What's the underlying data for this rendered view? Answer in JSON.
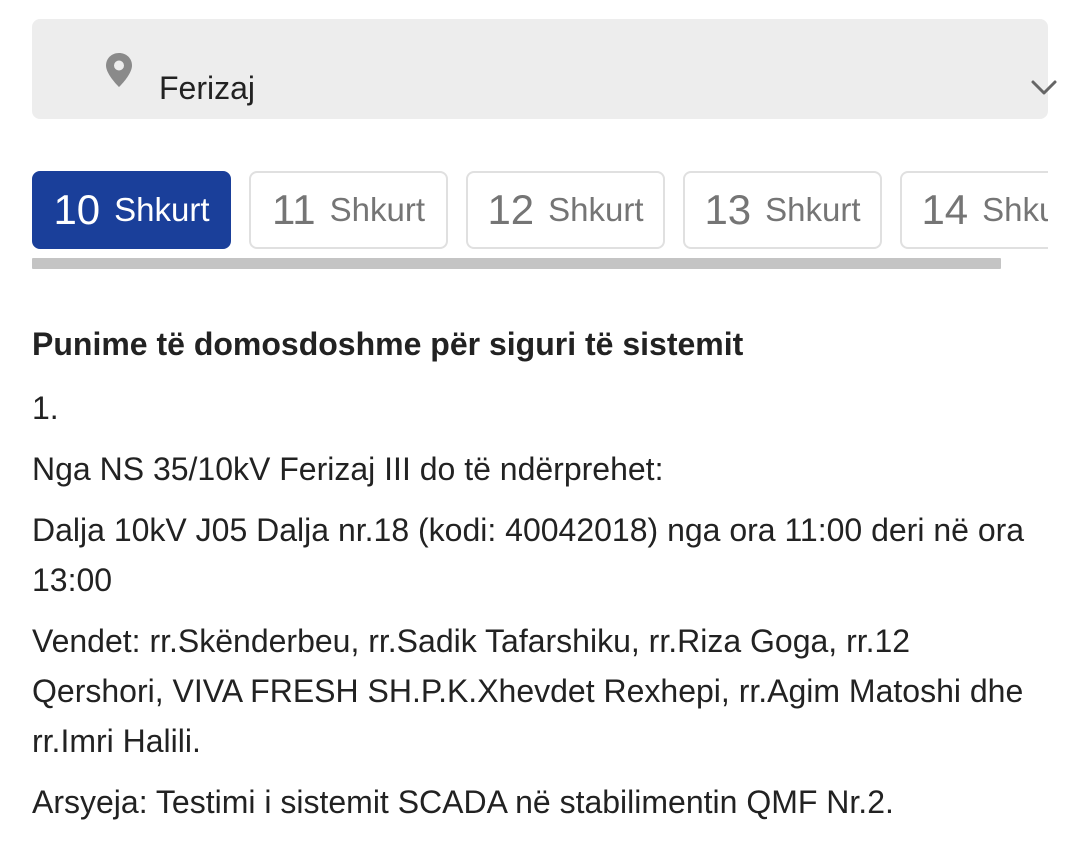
{
  "location": {
    "value": "Ferizaj",
    "pin_icon": "map-pin-icon",
    "dropdown_icon": "chevron-down-icon"
  },
  "tabs": [
    {
      "day": "10",
      "month": "Shkurt",
      "active": true
    },
    {
      "day": "11",
      "month": "Shkurt",
      "active": false
    },
    {
      "day": "12",
      "month": "Shkurt",
      "active": false
    },
    {
      "day": "13",
      "month": "Shkurt",
      "active": false
    },
    {
      "day": "14",
      "month": "Shkurt",
      "active": false
    }
  ],
  "colors": {
    "active_tab": "#1a3f9a",
    "select_bg": "#ededed",
    "scrollbar": "#c4c4c4"
  },
  "notice": {
    "heading": "Punime të domosdoshme për siguri të sistemit",
    "number": "1.",
    "source": "Nga NS 35/10kV Ferizaj III do të ndërprehet:",
    "feeder": "Dalja 10kV J05 Dalja nr.18 (kodi: 40042018) nga ora 11:00 deri në ora 13:00",
    "places": "Vendet: rr.Skënderbeu, rr.Sadik Tafarshiku, rr.Riza Goga, rr.12 Qershori, VIVA FRESH SH.P.K.Xhevdet Rexhepi, rr.Agim Matoshi dhe rr.Imri Halili.",
    "reason": "Arsyeja: Testimi i sistemit SCADA në stabilimentin QMF Nr.2."
  }
}
